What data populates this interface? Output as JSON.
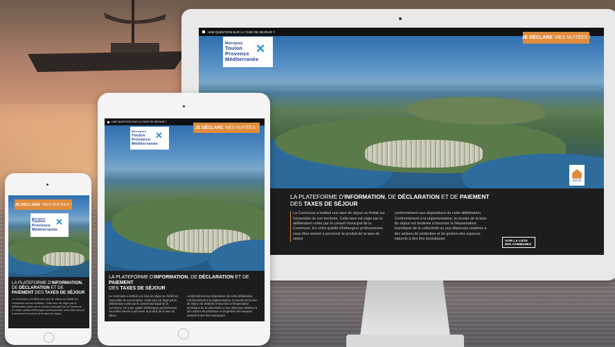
{
  "site": {
    "topbar_link": "UNE QUESTION SUR LA TAXE DE SÉJOUR ?",
    "logo_lines": [
      "Métropole",
      "Toulon",
      "Provence",
      "Méditerranée"
    ],
    "logo_mark": "✕",
    "declare_button": {
      "strong": "JE DÉCLARE",
      "rest": "MES NUITÉES !"
    },
    "headline": {
      "line1_pre": "LA PLATEFORME D'",
      "line1_bold1": "INFORMATION",
      "line1_mid": ", DE ",
      "line1_bold2": "DÉCLARATION",
      "line1_mid2": " ET DE ",
      "line1_bold3": "PAIEMENT",
      "line2_pre": "DES ",
      "line2_bold": "TAXES DE SÉJOUR"
    },
    "paragraph_left": "La Commune a institué une taxe de séjour au forfait sur l'ensemble de son territoire. Cette taxe est régie par la délibération votée par le conseil municipal de la Commune. En votre qualité d'hébergeur professionnel, vous êtes amené à percevoir le produit de la taxe de séjour",
    "paragraph_right": "conformément aux dispositions de cette délibération. Conformément à la réglementation, la recette de la taxe de séjour est destinée à favoriser la fréquentation touristique de la collectivité ou aux dépenses relatives à des actions de protection et de gestion des espaces naturels à des fins touristiques.",
    "communes_link": "VOIR LA LISTE DES COMMUNES",
    "badge_text": "TAXE DE SÉJOUR",
    "colors": {
      "accent_orange": "#e08b3c",
      "dark_bg": "#1d1d1f",
      "logo_blue": "#1f3f94"
    }
  },
  "icons": {
    "house_badge": "house-icon",
    "arrow": "arrow-icon"
  }
}
